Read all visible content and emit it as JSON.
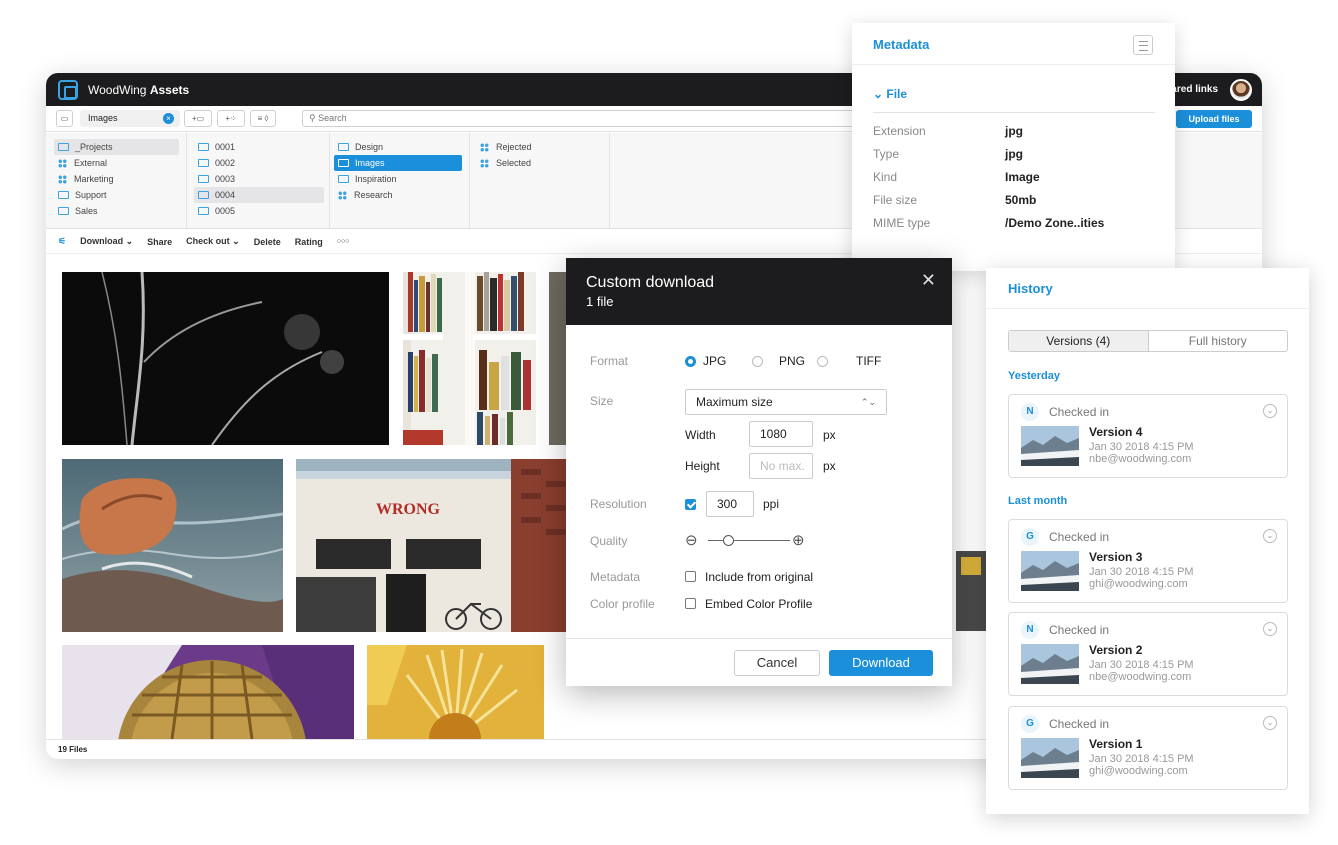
{
  "app": {
    "title_prefix": "WoodWing",
    "title_bold": "Assets",
    "shared_links": "Shared links",
    "upload_label": "Upload files"
  },
  "toolbar": {
    "breadcrumb": "Images",
    "add_folder": "+",
    "add_collection": "+",
    "sort": "≡ ◊",
    "search_placeholder": "Search"
  },
  "browser": {
    "col1": [
      "_Projects",
      "External",
      "Marketing",
      "Support",
      "Sales"
    ],
    "col2": [
      "0001",
      "0002",
      "0003",
      "0004",
      "0005"
    ],
    "col3": [
      "Design",
      "Images",
      "Inspiration",
      "Research"
    ],
    "col4": [
      "Rejected",
      "Selected"
    ]
  },
  "actions": {
    "download": "Download ⌄",
    "share": "Share",
    "checkout": "Check out ⌄",
    "delete": "Delete",
    "rating": "Rating",
    "more": "○○○"
  },
  "status": {
    "files": "19 Files"
  },
  "dialog": {
    "title": "Custom download",
    "subtitle": "1 file",
    "close": "✕",
    "labels": {
      "format": "Format",
      "size": "Size",
      "resolution": "Resolution",
      "quality": "Quality",
      "metadata": "Metadata",
      "color_profile": "Color profile"
    },
    "format_options": [
      "JPG",
      "PNG",
      "TIFF"
    ],
    "format_selected": "JPG",
    "size_value": "Maximum size",
    "width_label": "Width",
    "width_value": "1080",
    "height_label": "Height",
    "height_placeholder": "No max.",
    "unit_px": "px",
    "resolution_value": "300",
    "resolution_unit": "ppi",
    "resolution_checked": true,
    "quality_minus": "⊖",
    "quality_plus": "⊕",
    "quality_level": 0.25,
    "metadata_option": "Include from original",
    "color_profile_option": "Embed Color Profile",
    "cancel": "Cancel",
    "download": "Download"
  },
  "metadata_panel": {
    "title": "Metadata",
    "section": "⌄ File",
    "fields": [
      {
        "key": "Extension",
        "value": "jpg"
      },
      {
        "key": "Type",
        "value": "jpg"
      },
      {
        "key": "Kind",
        "value": "Image"
      },
      {
        "key": "File size",
        "value": "50mb"
      },
      {
        "key": "MIME type",
        "value": "/Demo Zone..ities"
      }
    ]
  },
  "history_panel": {
    "title": "History",
    "tabs": [
      "Versions (4)",
      "Full history"
    ],
    "groups": [
      "Yesterday",
      "Last month"
    ],
    "entries": [
      {
        "badge": "N",
        "action": "Checked in",
        "version": "Version 4",
        "date": "Jan 30 2018 4:15 PM",
        "email": "nbe@woodwing.com"
      },
      {
        "badge": "G",
        "action": "Checked in",
        "version": "Version 3",
        "date": "Jan 30 2018 4:15 PM",
        "email": "ghi@woodwing.com"
      },
      {
        "badge": "N",
        "action": "Checked in",
        "version": "Version 2",
        "date": "Jan 30 2018 4:15 PM",
        "email": "nbe@woodwing.com"
      },
      {
        "badge": "G",
        "action": "Checked in",
        "version": "Version 1",
        "date": "Jan 30 2018 4:15 PM",
        "email": "ghi@woodwing.com"
      }
    ]
  },
  "colors": {
    "accent": "#1b8fd9",
    "titlebar": "#1c1c1e"
  }
}
